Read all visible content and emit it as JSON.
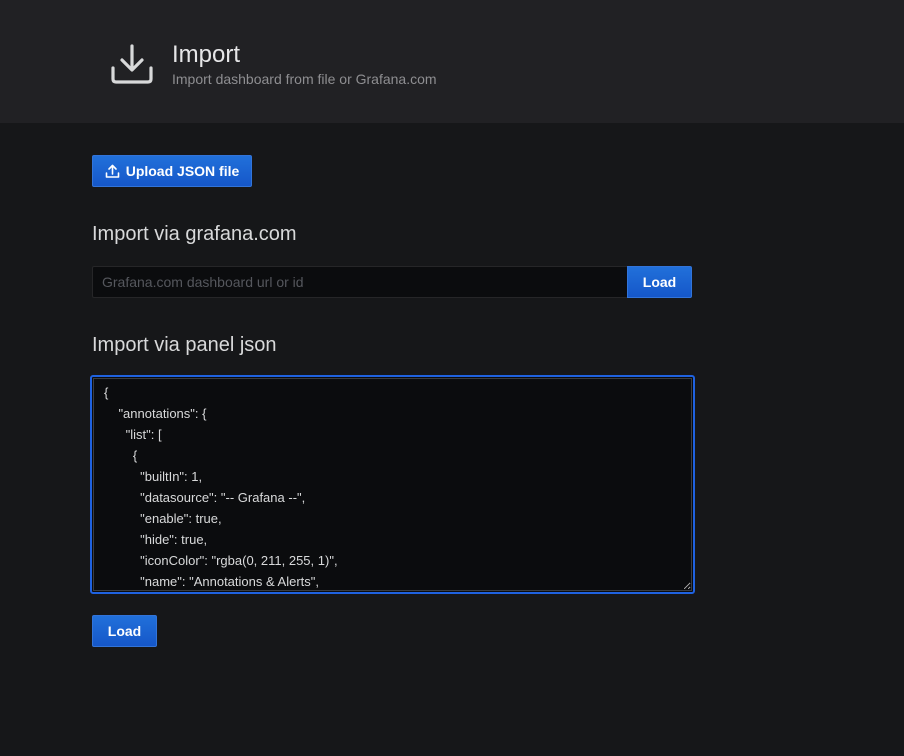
{
  "header": {
    "icon": "download-icon",
    "title": "Import",
    "subtitle": "Import dashboard from file or Grafana.com"
  },
  "upload": {
    "icon": "upload-icon",
    "label": "Upload JSON file"
  },
  "grafana_com": {
    "title": "Import via grafana.com",
    "input_value": "",
    "placeholder": "Grafana.com dashboard url or id",
    "load_label": "Load"
  },
  "panel_json": {
    "title": "Import via panel json",
    "value": "{\n    \"annotations\": {\n      \"list\": [\n        {\n          \"builtIn\": 1,\n          \"datasource\": \"-- Grafana --\",\n          \"enable\": true,\n          \"hide\": true,\n          \"iconColor\": \"rgba(0, 211, 255, 1)\",\n          \"name\": \"Annotations & Alerts\",\n          \"type\": \"dashboard\"\n        }\n      ]\n    },",
    "load_label": "Load"
  },
  "colors": {
    "background": "#161719",
    "header_background": "#212124",
    "primary_button": "#1f62e0",
    "focus_border": "#1f62e0"
  }
}
